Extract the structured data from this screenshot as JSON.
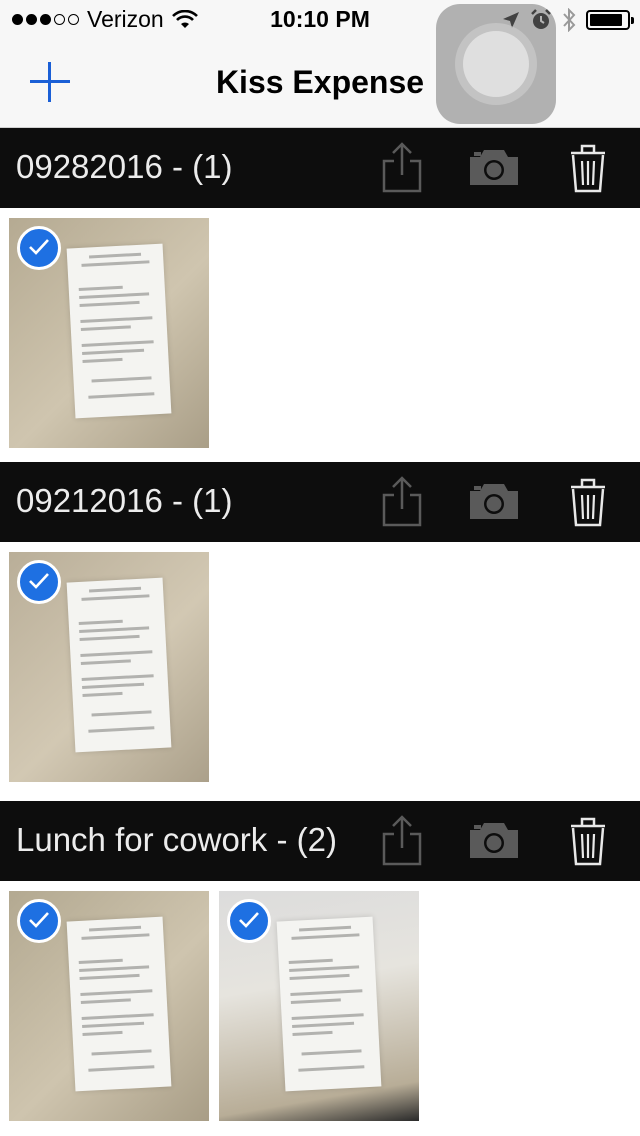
{
  "status_bar": {
    "carrier": "Verizon",
    "time": "10:10 PM",
    "signal_bars_filled": 3,
    "signal_bars_total": 5,
    "battery_level": 0.9,
    "icons": [
      "wifi-icon",
      "location-arrow-icon",
      "alarm-icon",
      "bluetooth-icon",
      "battery-icon"
    ]
  },
  "nav": {
    "title": "Kiss Expense",
    "add_icon": "plus-icon"
  },
  "colors": {
    "accent": "#1a5fd6",
    "header_bg": "#0d0d0d",
    "header_text": "#ececec",
    "header_icon": "#5a5a5a",
    "check_badge": "#1e70e2"
  },
  "sections": [
    {
      "title": "09282016 - (1)",
      "actions": [
        "share-icon",
        "camera-icon",
        "trash-icon"
      ],
      "photos": [
        {
          "selected": true,
          "icon": "receipt-thumbnail"
        }
      ]
    },
    {
      "title": "09212016 - (1)",
      "actions": [
        "share-icon",
        "camera-icon",
        "trash-icon"
      ],
      "photos": [
        {
          "selected": true,
          "icon": "receipt-thumbnail"
        }
      ]
    },
    {
      "title": "Lunch for cowork - (2)",
      "actions": [
        "share-icon",
        "camera-icon",
        "trash-icon"
      ],
      "photos": [
        {
          "selected": true,
          "icon": "receipt-thumbnail"
        },
        {
          "selected": true,
          "icon": "receipt-thumbnail"
        }
      ]
    }
  ]
}
